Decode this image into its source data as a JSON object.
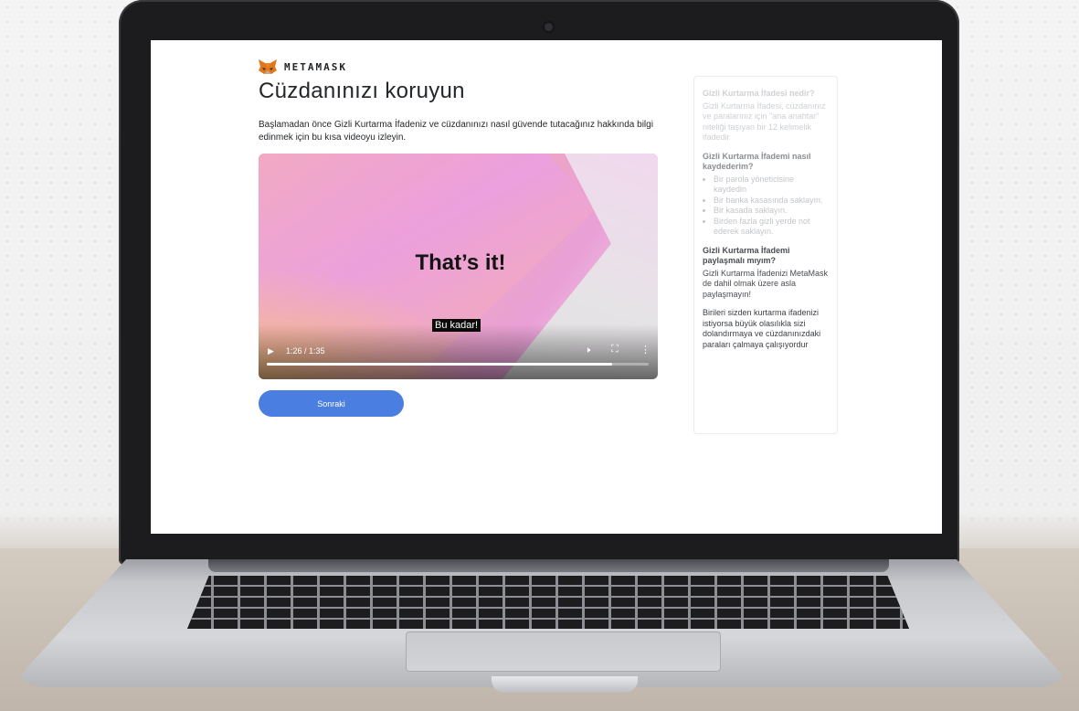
{
  "brand": {
    "name": "METAMASK",
    "logo_icon": "fox-icon"
  },
  "page": {
    "title": "Cüzdanınızı koruyun",
    "intro": "Başlamadan önce Gizli Kurtarma İfadeniz ve cüzdanınızı nasıl güvende tutacağınız hakkında bilgi edinmek için bu kısa videoyu izleyin."
  },
  "video": {
    "headline": "That’s it!",
    "caption": "Bu kadar!",
    "time": "1:26 / 1:35",
    "progress": 0.905,
    "play_icon": "play-icon",
    "volume_icon": "volume-icon",
    "fullscreen_icon": "fullscreen-icon",
    "more_icon": "more-vertical-icon"
  },
  "actions": {
    "next_label": "Sonraki"
  },
  "info": {
    "q1_title": "Gizli Kurtarma İfadesi nedir?",
    "q1_body": "Gizli Kurtarma İfadesi, cüzdanınız ve paralarınız için \"ana anahtar\" niteliği taşıyan bir 12 kelimelik ifadedir",
    "q2_title": "Gizli Kurtarma İfademi nasıl kaydederim?",
    "q2_items": [
      "Bir parola yöneticisine kaydedin",
      "Bir banka kasasında saklayın.",
      "Bir kasada saklayın.",
      "Birden fazla gizli yerde not ederek saklayın."
    ],
    "q3_title": "Gizli Kurtarma İfademi paylaşmalı mıyım?",
    "q3_body": "Gizli Kurtarma İfadenizi MetaMask de dahil olmak üzere asla paylaşmayın!",
    "warning": "Birileri sizden kurtarma ifadenizi istiyorsa büyük olasılıkla sizi dolandırmaya ve cüzdanınızdaki paraları çalmaya çalışıyordur"
  }
}
